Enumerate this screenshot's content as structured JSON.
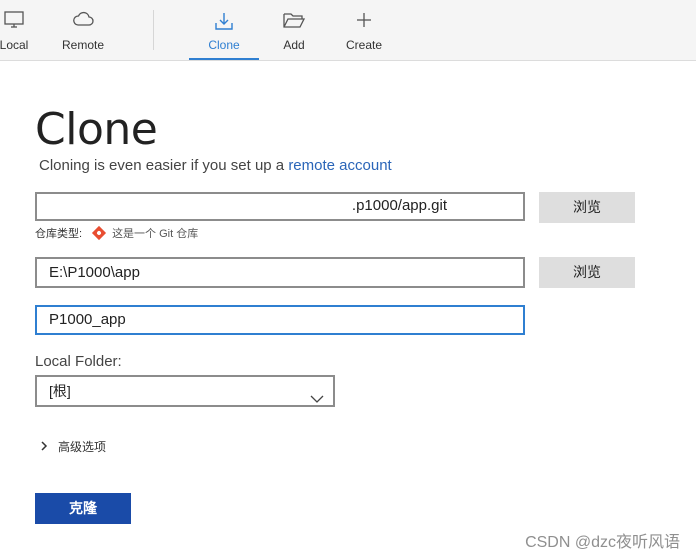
{
  "toolbar": {
    "items": [
      {
        "label": "Local",
        "icon": "monitor-icon"
      },
      {
        "label": "Remote",
        "icon": "cloud-icon"
      },
      {
        "label": "Clone",
        "icon": "download-icon",
        "active": true
      },
      {
        "label": "Add",
        "icon": "folder-open-icon"
      },
      {
        "label": "Create",
        "icon": "plus-icon"
      }
    ],
    "accent": "#2f7fd1"
  },
  "page": {
    "title": "Clone",
    "subtitle_text": "Cloning is even easier if you set up a ",
    "subtitle_link": "remote account"
  },
  "form": {
    "source_url": ".p1000/app.git",
    "browse_label": "浏览",
    "repo_type_label": "仓库类型:",
    "repo_type_value": "这是一个 Git 仓库",
    "destination_path": "E:\\P1000\\app",
    "browse_label_2": "浏览",
    "name": "P1000_app",
    "local_folder_label": "Local Folder:",
    "local_folder_value": "[根]",
    "advanced_label": "高级选项",
    "clone_button": "克隆"
  },
  "watermark": "CSDN @dzc夜听风语",
  "colors": {
    "primary_button": "#1a4ba8",
    "link": "#2a65b8",
    "git_icon": "#e84d31"
  }
}
